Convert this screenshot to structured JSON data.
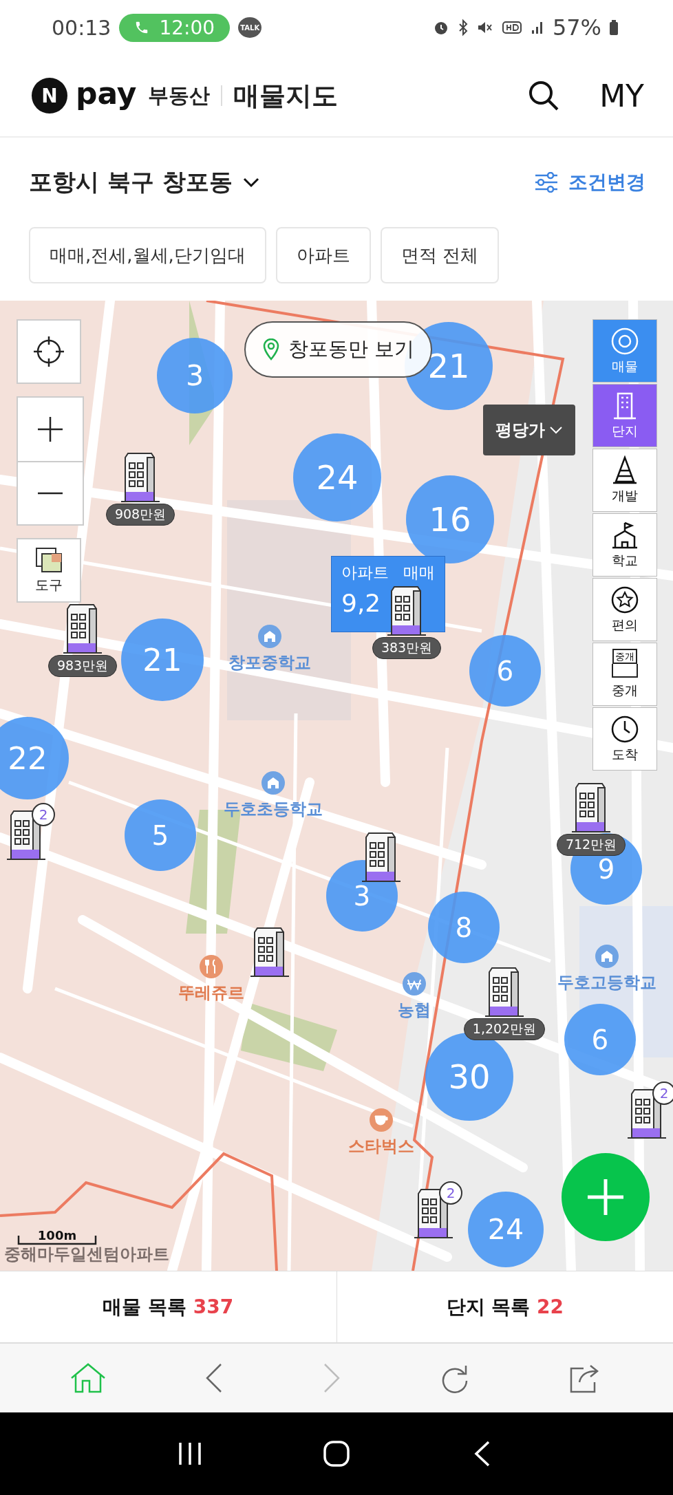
{
  "status_bar": {
    "time": "00:13",
    "call": "12:00",
    "talk": "TALK",
    "battery": "57%"
  },
  "header": {
    "logo_letter": "N",
    "logo_word": "pay",
    "service": "부동산",
    "title": "매물지도",
    "my": "MY"
  },
  "location": {
    "region": "포항시 북구 창포동",
    "change": "조건변경"
  },
  "filters": [
    "매매,전세,월세,단기임대",
    "아파트",
    "면적 전체"
  ],
  "map": {
    "area_button": "창포동만 보기",
    "price_type": "평당가",
    "tool": "도구",
    "scale": "100m",
    "rail": [
      {
        "kind": "listing",
        "label": "매물",
        "on": true,
        "color": "#3b8ef0"
      },
      {
        "kind": "complex",
        "label": "단지",
        "on": true,
        "color": "#8a5cf2"
      },
      {
        "kind": "develop",
        "label": "개발",
        "on": false
      },
      {
        "kind": "school",
        "label": "학교",
        "on": false
      },
      {
        "kind": "convenience",
        "label": "편의",
        "on": false
      },
      {
        "kind": "agent",
        "label": "중개",
        "icon_text": "중개",
        "on": false
      },
      {
        "kind": "commute",
        "label": "도착",
        "on": false
      }
    ],
    "clusters": [
      "3",
      "21",
      "24",
      "16",
      "21",
      "22",
      "6",
      "5",
      "3",
      "8",
      "9",
      "6",
      "30",
      "24"
    ],
    "markers": [
      {
        "kind": "price",
        "text": "908만원"
      },
      {
        "kind": "price",
        "text": "383만원"
      },
      {
        "kind": "price",
        "text": "983만원"
      },
      {
        "kind": "price",
        "text": "712만원"
      },
      {
        "kind": "price",
        "text": "1,202만원"
      },
      {
        "kind": "plain"
      },
      {
        "kind": "plain"
      },
      {
        "kind": "count",
        "text": "2"
      },
      {
        "kind": "count",
        "text": "2"
      },
      {
        "kind": "count",
        "text": "2"
      }
    ],
    "popup": {
      "type": "아파트",
      "deal": "매매",
      "price": "9,2"
    },
    "places": [
      {
        "kind": "school",
        "name": "창포중학교"
      },
      {
        "kind": "school",
        "name": "두호초등학교"
      },
      {
        "kind": "food",
        "name": "뚜레쥬르"
      },
      {
        "kind": "bank",
        "name": "농협"
      },
      {
        "kind": "cafe",
        "name": "스타벅스"
      },
      {
        "kind": "school",
        "name": "두호고등학교"
      },
      {
        "kind": "plain",
        "name": "중해마두일센텀아파트"
      }
    ]
  },
  "lists": [
    {
      "label": "매물 목록",
      "count": "337"
    },
    {
      "label": "단지 목록",
      "count": "22"
    }
  ],
  "browser_nav": [
    {
      "kind": "home",
      "selected": true,
      "disabled": false
    },
    {
      "kind": "back",
      "selected": false,
      "disabled": false
    },
    {
      "kind": "forward",
      "selected": false,
      "disabled": true
    },
    {
      "kind": "refresh",
      "selected": false,
      "disabled": false
    },
    {
      "kind": "share",
      "selected": false,
      "disabled": false
    }
  ],
  "system_nav": [
    {
      "kind": "recents"
    },
    {
      "kind": "home"
    },
    {
      "kind": "back"
    }
  ]
}
